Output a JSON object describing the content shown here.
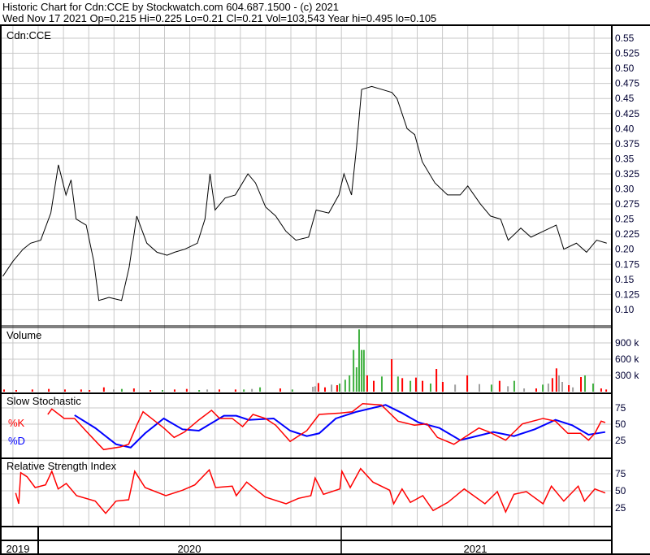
{
  "header": {
    "line1": "Historic Chart for Cdn:CCE by Stockwatch.com 604.687.1500 - (c) 2021",
    "line2": "Wed Nov 17 2021  Op=0.215  Hi=0.225  Lo=0.21  Cl=0.21  Vol=103,543  Year hi=0.495  lo=0.105"
  },
  "colors": {
    "price": "#000000",
    "up": "#40b040",
    "down": "#ff0000",
    "flat": "#a0a0a0",
    "k": "#ff0000",
    "d": "#0000ff",
    "rsi": "#ff0000",
    "grid": "#c8c8c8",
    "axis_text": "#000033"
  },
  "chart_data": [
    {
      "type": "line",
      "title": "Cdn:CCE",
      "x_unit": "months since Jan 2020",
      "xlim": [
        -1.45,
        22.55
      ],
      "ylim": [
        0.1,
        0.55
      ],
      "ytick_labels": [
        "0.55",
        "0.525",
        "0.50",
        "0.475",
        "0.45",
        "0.425",
        "0.40",
        "0.375",
        "0.35",
        "0.325",
        "0.30",
        "0.275",
        "0.25",
        "0.225",
        "0.20",
        "0.175",
        "0.15",
        "0.125",
        "0.10"
      ],
      "grid": true,
      "x": [
        -1.4,
        -1.0,
        -0.6,
        -0.3,
        0.1,
        0.5,
        0.8,
        1.1,
        1.3,
        1.5,
        1.9,
        2.2,
        2.4,
        2.8,
        3.3,
        3.6,
        3.9,
        4.3,
        4.7,
        5.1,
        5.4,
        5.8,
        6.3,
        6.6,
        6.8,
        7.0,
        7.4,
        7.8,
        8.3,
        8.6,
        9.0,
        9.4,
        9.8,
        10.2,
        10.7,
        11.0,
        11.5,
        11.9,
        12.1,
        12.4,
        12.6,
        12.8,
        13.2,
        13.6,
        14.0,
        14.2,
        14.6,
        14.9,
        15.2,
        15.7,
        16.2,
        16.7,
        17.0,
        17.5,
        17.9,
        18.3,
        18.6,
        19.1,
        19.5,
        20.0,
        20.5,
        20.8,
        21.3,
        21.7,
        22.1,
        22.5
      ],
      "y": [
        0.155,
        0.18,
        0.2,
        0.21,
        0.215,
        0.26,
        0.34,
        0.29,
        0.315,
        0.25,
        0.24,
        0.18,
        0.115,
        0.12,
        0.115,
        0.17,
        0.255,
        0.21,
        0.195,
        0.19,
        0.195,
        0.2,
        0.21,
        0.25,
        0.325,
        0.265,
        0.285,
        0.29,
        0.325,
        0.31,
        0.27,
        0.255,
        0.23,
        0.215,
        0.22,
        0.265,
        0.26,
        0.29,
        0.325,
        0.29,
        0.37,
        0.465,
        0.47,
        0.465,
        0.46,
        0.45,
        0.4,
        0.39,
        0.345,
        0.31,
        0.29,
        0.29,
        0.305,
        0.275,
        0.255,
        0.25,
        0.215,
        0.235,
        0.22,
        0.23,
        0.24,
        0.2,
        0.21,
        0.195,
        0.215,
        0.21
      ]
    },
    {
      "type": "bar",
      "title": "Volume",
      "ytick_labels": [
        "900 k",
        "600 k",
        "300 k"
      ],
      "ylim": [
        0,
        1200
      ],
      "y_unit": "thousands of shares",
      "bars": [
        [
          -1.35,
          40,
          "down"
        ],
        [
          -0.87,
          30,
          "down"
        ],
        [
          -0.23,
          40,
          "down"
        ],
        [
          0.42,
          50,
          "down"
        ],
        [
          1.06,
          40,
          "down"
        ],
        [
          1.7,
          40,
          "down"
        ],
        [
          2.03,
          30,
          "down"
        ],
        [
          2.6,
          80,
          "down"
        ],
        [
          2.99,
          40,
          "flat"
        ],
        [
          3.31,
          50,
          "up"
        ],
        [
          3.79,
          60,
          "down"
        ],
        [
          4.44,
          30,
          "down"
        ],
        [
          4.92,
          30,
          "up"
        ],
        [
          5.4,
          40,
          "down"
        ],
        [
          5.88,
          50,
          "down"
        ],
        [
          6.37,
          30,
          "up"
        ],
        [
          6.69,
          40,
          "flat"
        ],
        [
          7.17,
          40,
          "down"
        ],
        [
          7.81,
          40,
          "down"
        ],
        [
          8.14,
          40,
          "up"
        ],
        [
          8.46,
          50,
          "flat"
        ],
        [
          8.78,
          80,
          "up"
        ],
        [
          9.58,
          60,
          "down"
        ],
        [
          10.06,
          40,
          "up"
        ],
        [
          10.87,
          90,
          "flat"
        ],
        [
          10.96,
          100,
          "flat"
        ],
        [
          11.09,
          160,
          "down"
        ],
        [
          11.35,
          80,
          "down"
        ],
        [
          11.61,
          130,
          "flat"
        ],
        [
          11.83,
          120,
          "down"
        ],
        [
          11.93,
          150,
          "up"
        ],
        [
          12.15,
          220,
          "up"
        ],
        [
          12.32,
          300,
          "up"
        ],
        [
          12.48,
          770,
          "up"
        ],
        [
          12.6,
          450,
          "up"
        ],
        [
          12.7,
          1150,
          "up"
        ],
        [
          12.8,
          770,
          "up"
        ],
        [
          12.89,
          770,
          "up"
        ],
        [
          13.02,
          300,
          "down"
        ],
        [
          13.28,
          200,
          "down"
        ],
        [
          13.6,
          280,
          "up"
        ],
        [
          13.99,
          600,
          "down"
        ],
        [
          14.24,
          280,
          "up"
        ],
        [
          14.41,
          250,
          "down"
        ],
        [
          14.73,
          200,
          "up"
        ],
        [
          14.95,
          260,
          "down"
        ],
        [
          15.21,
          200,
          "down"
        ],
        [
          15.53,
          150,
          "up"
        ],
        [
          15.76,
          420,
          "down"
        ],
        [
          16.01,
          180,
          "down"
        ],
        [
          16.5,
          130,
          "flat"
        ],
        [
          16.98,
          300,
          "down"
        ],
        [
          17.46,
          140,
          "flat"
        ],
        [
          17.94,
          130,
          "up"
        ],
        [
          18.26,
          200,
          "down"
        ],
        [
          18.59,
          100,
          "flat"
        ],
        [
          18.84,
          200,
          "up"
        ],
        [
          19.23,
          60,
          "flat"
        ],
        [
          19.71,
          60,
          "down"
        ],
        [
          19.97,
          130,
          "up"
        ],
        [
          20.19,
          150,
          "flat"
        ],
        [
          20.35,
          250,
          "down"
        ],
        [
          20.51,
          430,
          "down"
        ],
        [
          20.61,
          300,
          "flat"
        ],
        [
          20.74,
          180,
          "flat"
        ],
        [
          21.0,
          120,
          "down"
        ],
        [
          21.16,
          80,
          "flat"
        ],
        [
          21.48,
          270,
          "down"
        ],
        [
          21.64,
          300,
          "up"
        ],
        [
          21.96,
          150,
          "up"
        ],
        [
          22.28,
          60,
          "down"
        ],
        [
          22.48,
          40,
          "down"
        ]
      ]
    },
    {
      "type": "line",
      "title": "Slow Stochastic",
      "ylim": [
        0,
        100
      ],
      "ytick_labels": [
        "75",
        "50",
        "25"
      ],
      "series": [
        {
          "name": "%K",
          "x": [
            0.38,
            0.54,
            1.03,
            1.44,
            1.93,
            2.59,
            3.25,
            3.58,
            3.9,
            4.15,
            4.56,
            4.97,
            5.38,
            5.79,
            6.36,
            6.86,
            7.18,
            7.68,
            8.09,
            8.5,
            8.99,
            9.4,
            9.97,
            10.63,
            11.12,
            11.94,
            12.43,
            12.84,
            13.58,
            14.24,
            14.89,
            15.39,
            15.8,
            16.45,
            17.03,
            17.44,
            17.85,
            18.5,
            19.16,
            19.98,
            20.47,
            20.96,
            21.46,
            21.78,
            22.03,
            22.28,
            22.44
          ],
          "y": [
            65,
            73.4,
            58.8,
            58.8,
            37.9,
            10.9,
            15,
            19.1,
            48.4,
            69.1,
            56.6,
            44.1,
            29.6,
            37.9,
            56.6,
            71.3,
            58.8,
            58.8,
            46.3,
            65,
            58.8,
            48.4,
            23.4,
            40,
            65,
            67.1,
            69.1,
            81.6,
            79.6,
            54.6,
            48.4,
            50.4,
            29.6,
            19.1,
            33.8,
            44.1,
            37.9,
            25.4,
            50.4,
            58.8,
            54.6,
            35.9,
            35.9,
            25.4,
            35.9,
            54.6,
            52.5
          ]
        },
        {
          "name": "%D",
          "x": [
            1.44,
            2.26,
            3.08,
            3.66,
            4.23,
            4.97,
            5.71,
            6.36,
            7.35,
            7.84,
            8.33,
            9.32,
            9.97,
            10.63,
            11.12,
            11.78,
            12.6,
            13.75,
            14.4,
            15.06,
            15.88,
            16.7,
            17.35,
            18.01,
            18.83,
            19.65,
            20.47,
            21.13,
            21.78,
            22.44
          ],
          "y": [
            63.8,
            44.1,
            19.1,
            14.1,
            35.9,
            58.8,
            42.1,
            40,
            62.9,
            62.9,
            56.6,
            58.8,
            40,
            31.6,
            35.9,
            58.8,
            69.1,
            79.6,
            67.1,
            52.5,
            44.1,
            25.4,
            31.6,
            37.9,
            31.6,
            42.1,
            56.6,
            48.4,
            33.8,
            37.9
          ]
        }
      ]
    },
    {
      "type": "line",
      "title": "Relative Strength Index",
      "ylim": [
        0,
        100
      ],
      "ytick_labels": [
        "75",
        "50",
        "25"
      ],
      "x": [
        -0.89,
        -0.77,
        -0.69,
        -0.44,
        -0.12,
        0.29,
        0.54,
        0.79,
        1.11,
        1.52,
        2.26,
        2.67,
        3.08,
        3.58,
        3.82,
        4.23,
        5.05,
        5.71,
        6.2,
        6.77,
        7.02,
        7.68,
        7.84,
        8.25,
        8.99,
        9.81,
        10.3,
        10.79,
        10.96,
        11.29,
        11.94,
        12.02,
        12.35,
        12.76,
        13.25,
        13.91,
        14.07,
        14.4,
        14.73,
        15.22,
        15.63,
        16.21,
        16.86,
        17.68,
        18.17,
        18.5,
        18.83,
        19.32,
        19.98,
        20.31,
        20.8,
        21.37,
        21.62,
        22.03,
        22.44
      ],
      "y": [
        46.8,
        31,
        76.5,
        70.6,
        54.8,
        58.7,
        78.6,
        52.7,
        60.7,
        42.9,
        34.9,
        17,
        34.9,
        36.9,
        78.6,
        54.8,
        42.9,
        50.8,
        58.7,
        80.6,
        54.8,
        56.8,
        42.9,
        62.7,
        40.8,
        31,
        38.9,
        42.9,
        68.7,
        44.9,
        52.7,
        78.6,
        54.8,
        82.5,
        62.7,
        50.8,
        31,
        52.7,
        33,
        42.9,
        21.1,
        33,
        52.7,
        31,
        48.8,
        19,
        44.9,
        48.8,
        31,
        56.8,
        34.9,
        56.8,
        34.9,
        52.7,
        46.8
      ]
    }
  ],
  "labels": {
    "k": "%K",
    "d": "%D"
  },
  "timeline": {
    "years": [
      "2019",
      "2020",
      "2021"
    ]
  }
}
